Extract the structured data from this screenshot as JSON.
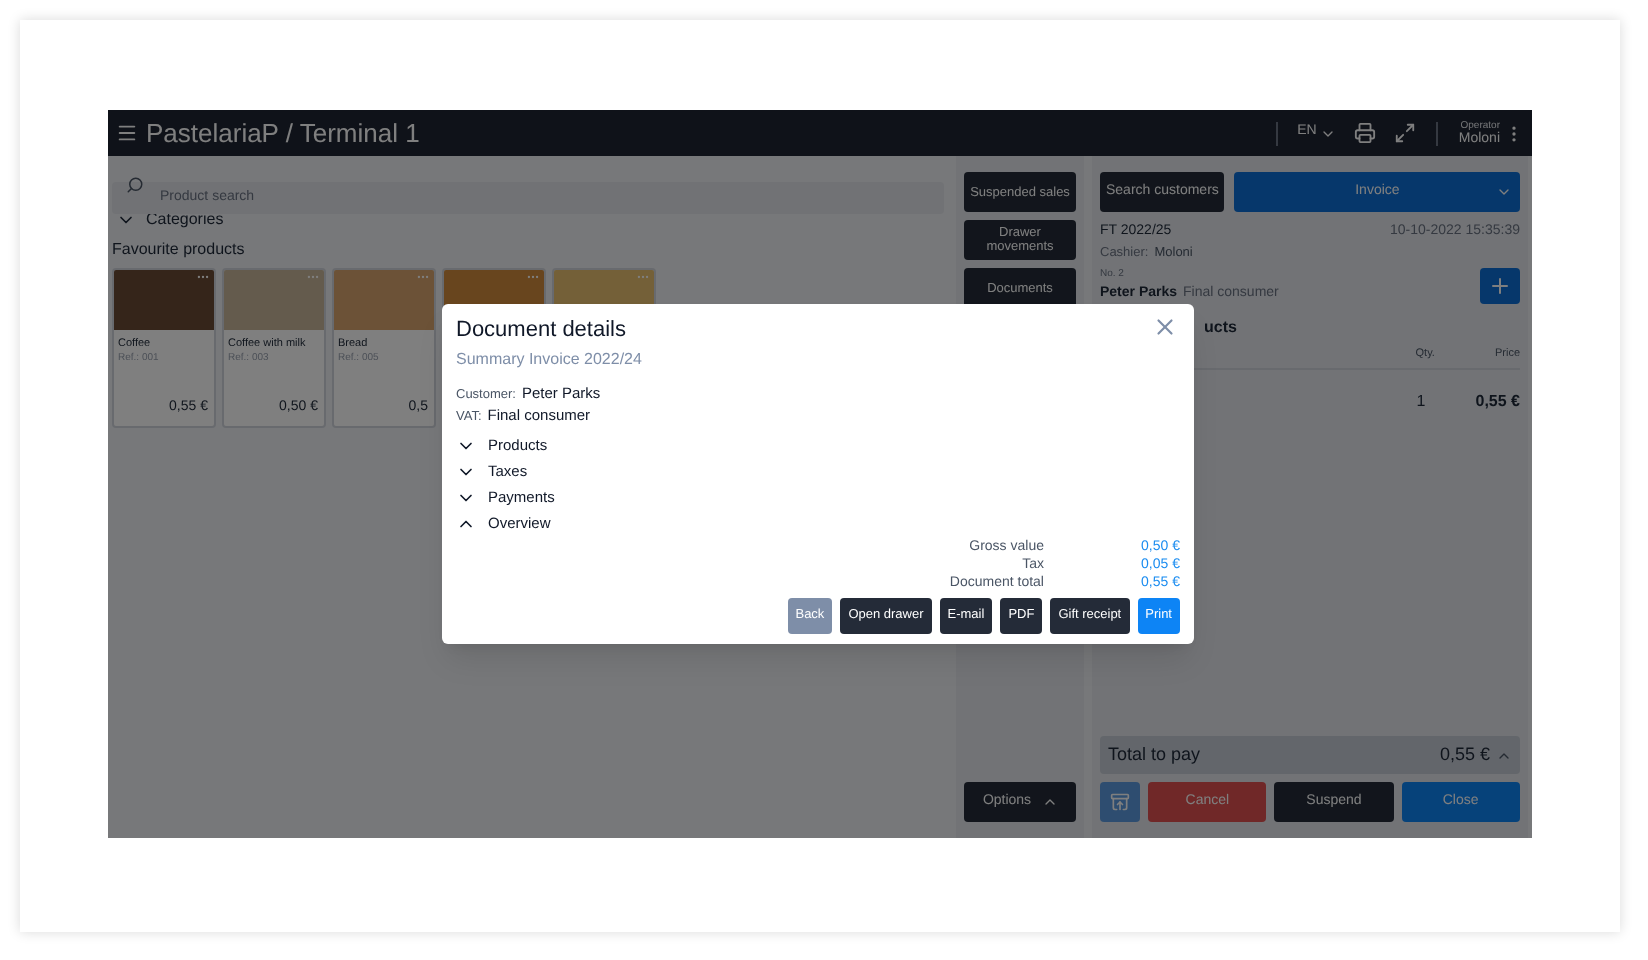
{
  "header": {
    "title": "PastelariaP / Terminal 1",
    "language": "EN",
    "operator_label": "Operator",
    "operator": "Moloni"
  },
  "left": {
    "search_placeholder": "Product search",
    "categories": {
      "label": "Categories",
      "expanded": false
    },
    "favourites_title": "Favourite products",
    "products": [
      {
        "kind": "full",
        "name": "Coffee",
        "ref": "Ref.: 001",
        "price": "0,55 €"
      },
      {
        "kind": "full",
        "name": "Coffee with milk",
        "ref": "Ref.: 003",
        "price": "0,50 €"
      },
      {
        "kind": "full",
        "name": "Bread",
        "ref": "Ref.: 005",
        "price": "0,5"
      },
      {
        "kind": "covered"
      },
      {
        "kind": "covered"
      }
    ]
  },
  "middle": {
    "buttons": [
      "Suspended sales",
      "Drawer movements",
      "Documents"
    ],
    "options": "Options"
  },
  "right": {
    "search_customers": "Search customers",
    "document_type": "Invoice",
    "doc_number": "FT 2022/25",
    "date": "10-10-2022 15:35:39",
    "cashier_label": "Cashier:",
    "cashier": "Moloni",
    "customer_no": "No. 2",
    "customer_name": "Peter Parks",
    "customer_vat": "Final consumer",
    "products_heading": "ucts",
    "columns": [
      "Qty.",
      "Price"
    ],
    "line": {
      "qty": "1",
      "price": "0,55 €"
    },
    "total_label": "Total to pay",
    "total": "0,55 €",
    "buttons": [
      {
        "label": "Cancel",
        "kind": "danger"
      },
      {
        "label": "Suspend",
        "kind": "dark"
      },
      {
        "label": "Close",
        "kind": "primary"
      }
    ]
  },
  "modal": {
    "title": "Document details",
    "subtitle": "Summary Invoice 2022/24",
    "customer_label": "Customer:",
    "customer": "Peter Parks",
    "vat_label": "VAT:",
    "vat": "Final consumer",
    "sections": [
      {
        "label": "Products",
        "expanded": false
      },
      {
        "label": "Taxes",
        "expanded": false
      },
      {
        "label": "Payments",
        "expanded": false
      },
      {
        "label": "Overview",
        "expanded": true
      }
    ],
    "overview": [
      {
        "label": "Gross value",
        "value": "0,50 €"
      },
      {
        "label": "Tax",
        "value": "0,05 €"
      },
      {
        "label": "Document total",
        "value": "0,55 €"
      }
    ],
    "buttons": [
      {
        "label": "Back",
        "kind": "secondary"
      },
      {
        "label": "Open drawer",
        "kind": "dark"
      },
      {
        "label": "E-mail",
        "kind": "dark"
      },
      {
        "label": "PDF",
        "kind": "dark"
      },
      {
        "label": "Gift receipt",
        "kind": "dark"
      },
      {
        "label": "Print",
        "kind": "primary"
      }
    ]
  }
}
